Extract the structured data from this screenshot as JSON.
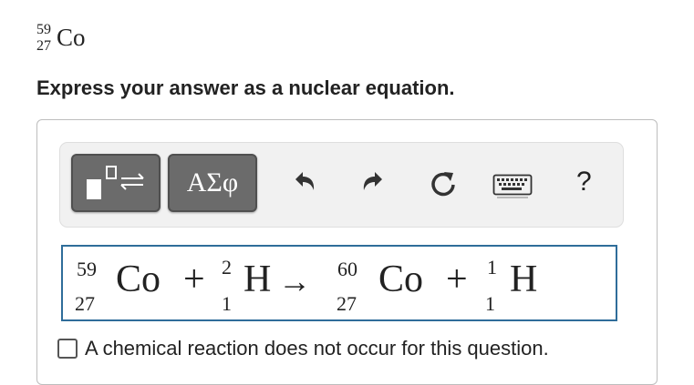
{
  "question": {
    "nuclide": {
      "mass_number": "59",
      "atomic_number": "27",
      "symbol": "Co"
    },
    "prompt": "Express your answer as a nuclear equation."
  },
  "toolbar": {
    "template_button_icon": "templates-icon",
    "greek_button_label": "ΑΣφ",
    "undo_icon": "undo-icon",
    "redo_icon": "redo-icon",
    "reset_icon": "reset-icon",
    "keyboard_icon": "keyboard-icon",
    "help_label": "?"
  },
  "equation": {
    "term1": {
      "mass": "59",
      "atomic": "27",
      "symbol": "Co"
    },
    "plus1": "+",
    "term2": {
      "mass": "2",
      "atomic": "1",
      "symbol": "H"
    },
    "arrow": "→",
    "term3": {
      "mass": "60",
      "atomic": "27",
      "symbol": "Co"
    },
    "plus2": "+",
    "term4": {
      "mass": "1",
      "atomic": "1",
      "symbol": "H"
    }
  },
  "no_reaction": {
    "label": "A chemical reaction does not occur for this question.",
    "checked": false
  },
  "colors": {
    "button_dark": "#6b6b6b",
    "equation_border": "#2f6d9a",
    "toolbar_bg": "#f1f1f1"
  }
}
